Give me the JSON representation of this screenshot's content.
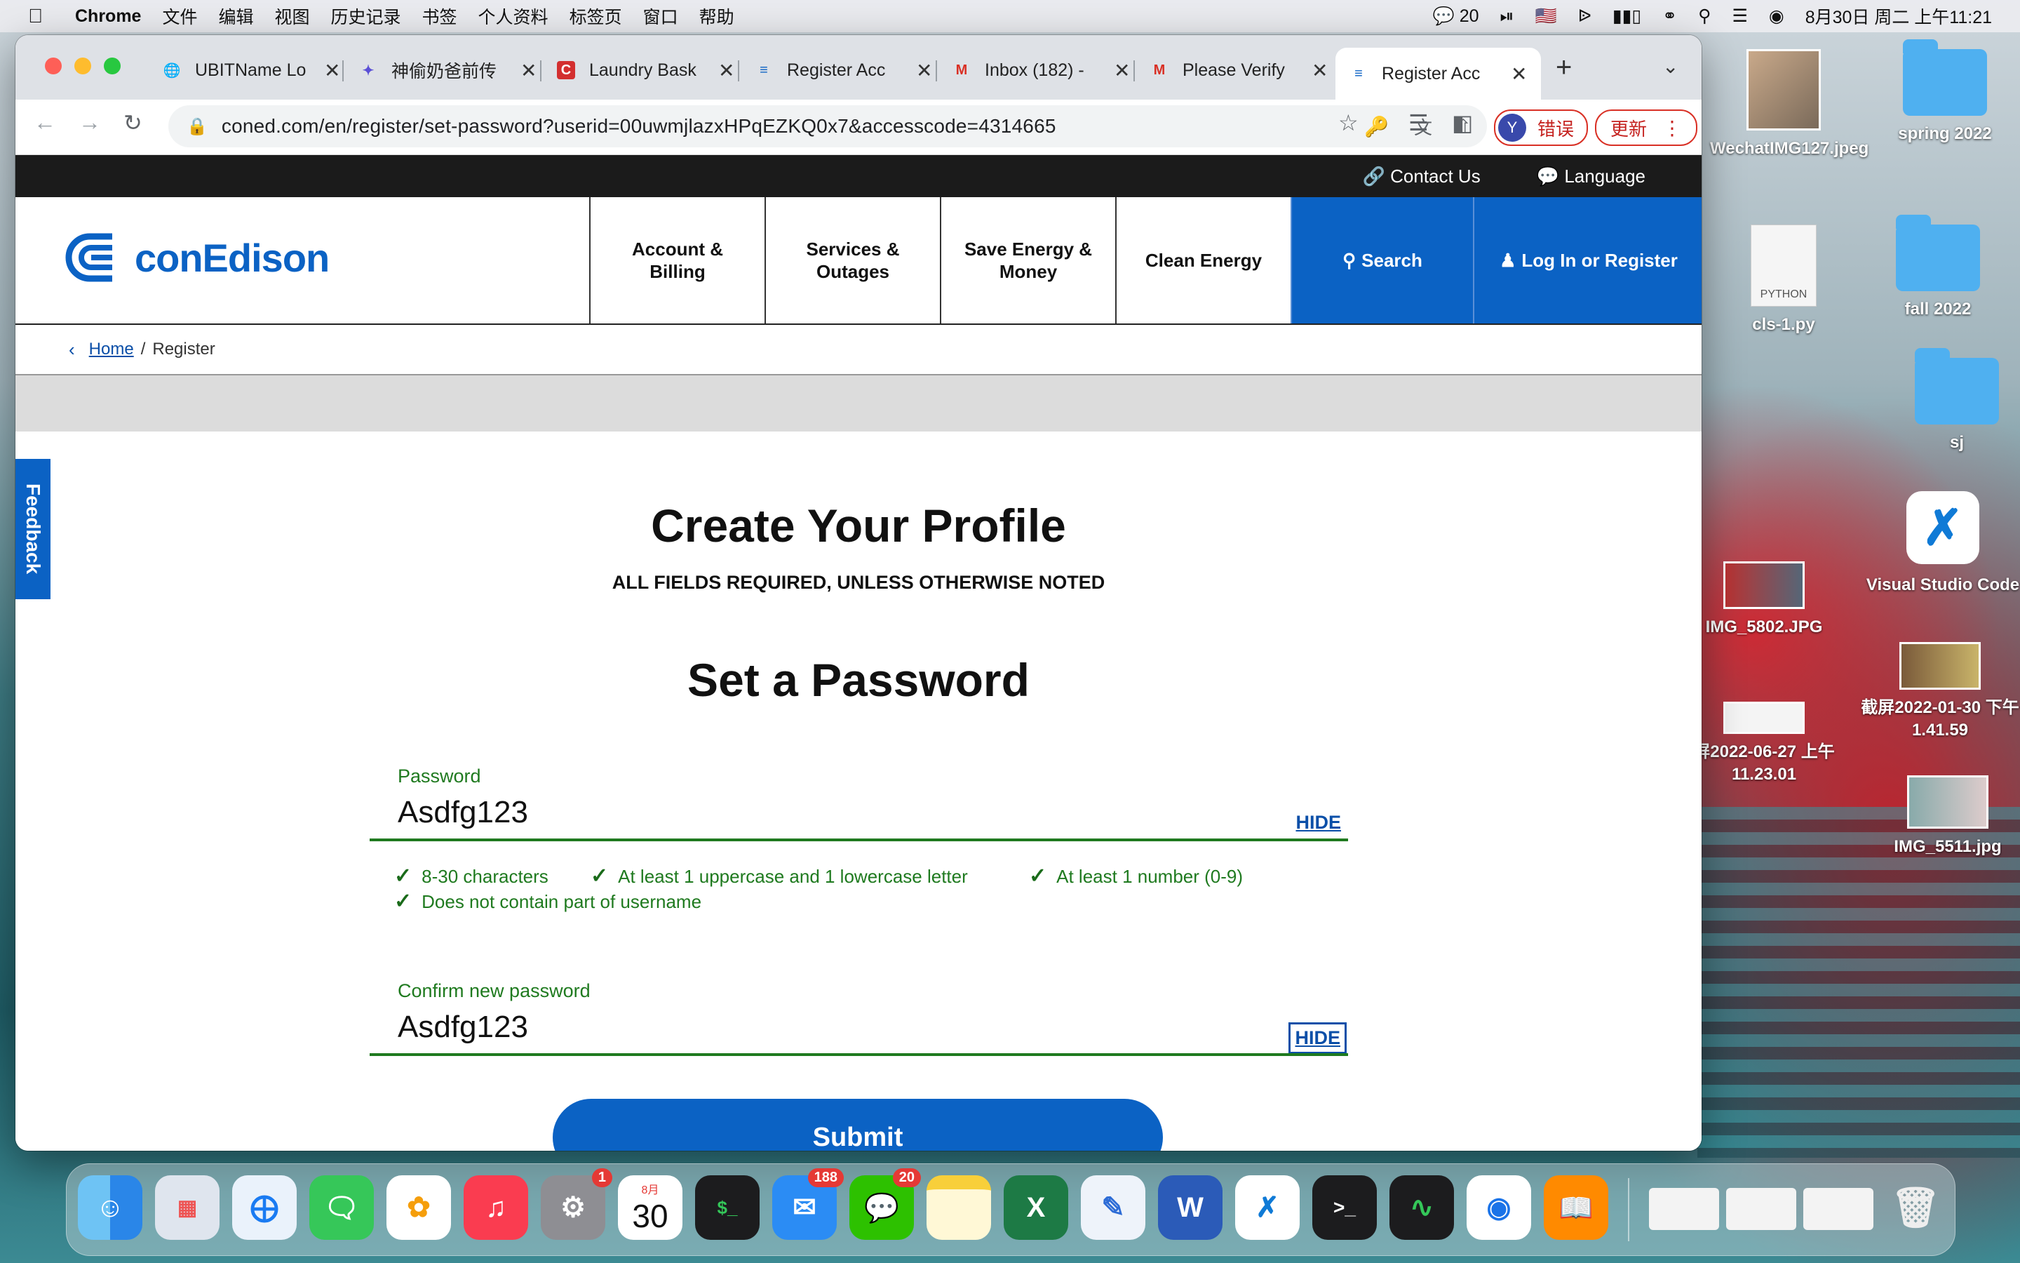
{
  "menubar": {
    "app": "Chrome",
    "items": [
      "文件",
      "编辑",
      "视图",
      "历史记录",
      "书签",
      "个人资料",
      "标签页",
      "窗口",
      "帮助"
    ],
    "wechat_count": "20",
    "datetime": "8月30日 周二 上午11:21"
  },
  "tabs": [
    {
      "title": "UBITName Lo",
      "icon": "globe-icon"
    },
    {
      "title": "神偷奶爸前传",
      "icon": "app-icon"
    },
    {
      "title": "Laundry Bask",
      "icon": "c-logo-icon"
    },
    {
      "title": "Register Acc",
      "icon": "conedison-icon"
    },
    {
      "title": "Inbox (182) -",
      "icon": "gmail-icon"
    },
    {
      "title": "Please Verify",
      "icon": "gmail-icon"
    },
    {
      "title": "Register Acc",
      "icon": "conedison-icon",
      "active": true
    }
  ],
  "toolbar": {
    "url": "coned.com/en/register/set-password?userid=00uwmjlazxHPqEZKQ0x7&accesscode=4314665",
    "profile_initial": "Y",
    "error_label": "错误",
    "update_label": "更新"
  },
  "site": {
    "utility": {
      "contact": "Contact Us",
      "language": "Language"
    },
    "logo": "conEdison",
    "nav": [
      {
        "line1": "Account &",
        "line2": "Billing"
      },
      {
        "line1": "Services &",
        "line2": "Outages"
      },
      {
        "line1": "Save Energy &",
        "line2": "Money"
      },
      {
        "line1": "Clean Energy",
        "line2": ""
      }
    ],
    "search": "Search",
    "login": "Log In or Register",
    "breadcrumb": {
      "home": "Home",
      "current": "Register"
    },
    "feedback": "Feedback"
  },
  "form": {
    "title": "Create Your Profile",
    "subtitle": "ALL FIELDS REQUIRED, UNLESS OTHERWISE NOTED",
    "section": "Set a Password",
    "password": {
      "label": "Password",
      "value": "Asdfg123",
      "toggle": "HIDE"
    },
    "rules": [
      "8-30 characters",
      "At least 1 uppercase and 1 lowercase letter",
      "At least 1 number (0-9)",
      "Does not contain part of username"
    ],
    "confirm": {
      "label": "Confirm new password",
      "value": "Asdfg123",
      "toggle": "HIDE"
    },
    "submit": "Submit"
  },
  "desktop": {
    "icons": [
      {
        "name": "WechatIMG127.jpeg"
      },
      {
        "name": "spring 2022"
      },
      {
        "name": "cls-1.py",
        "tag": "PYTHON"
      },
      {
        "name": "fall 2022"
      },
      {
        "name": "sj"
      },
      {
        "name": "Visual Studio Code"
      },
      {
        "name": "IMG_5802.JPG"
      },
      {
        "name": "截屏2022-01-30 下午1.41.59"
      },
      {
        "name": "屏2022-06-27 上午11.23.01"
      },
      {
        "name": "IMG_5511.jpg"
      }
    ]
  },
  "dock": {
    "calendar_month": "8月",
    "calendar_day": "30",
    "badges": {
      "settings": "1",
      "mail": "188",
      "wechat": "20"
    }
  }
}
